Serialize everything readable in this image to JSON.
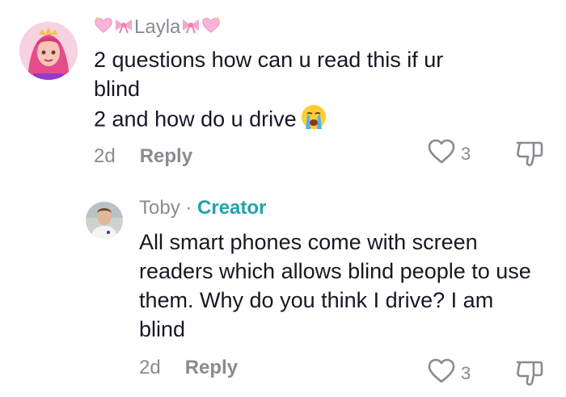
{
  "comments": [
    {
      "username": "Layla",
      "text_line1": "2 questions how can u read this if ur",
      "text_line2": "blind",
      "text_line3": "2 and how do u drive",
      "time": "2d",
      "reply_label": "Reply",
      "like_count": "3"
    },
    {
      "username": "Toby",
      "separator": " · ",
      "badge": "Creator",
      "text": "All smart phones come with screen readers which allows blind people to use them. Why do you think I drive? I am blind",
      "time": "2d",
      "reply_label": "Reply",
      "like_count": "3"
    }
  ],
  "icons": {
    "like": "heart-outline-icon",
    "dislike": "thumbs-down-icon",
    "emoji": "loudly-crying-face"
  },
  "colors": {
    "text": "#161823",
    "secondary": "#8a8b91",
    "creator_badge": "#20a3ad"
  }
}
